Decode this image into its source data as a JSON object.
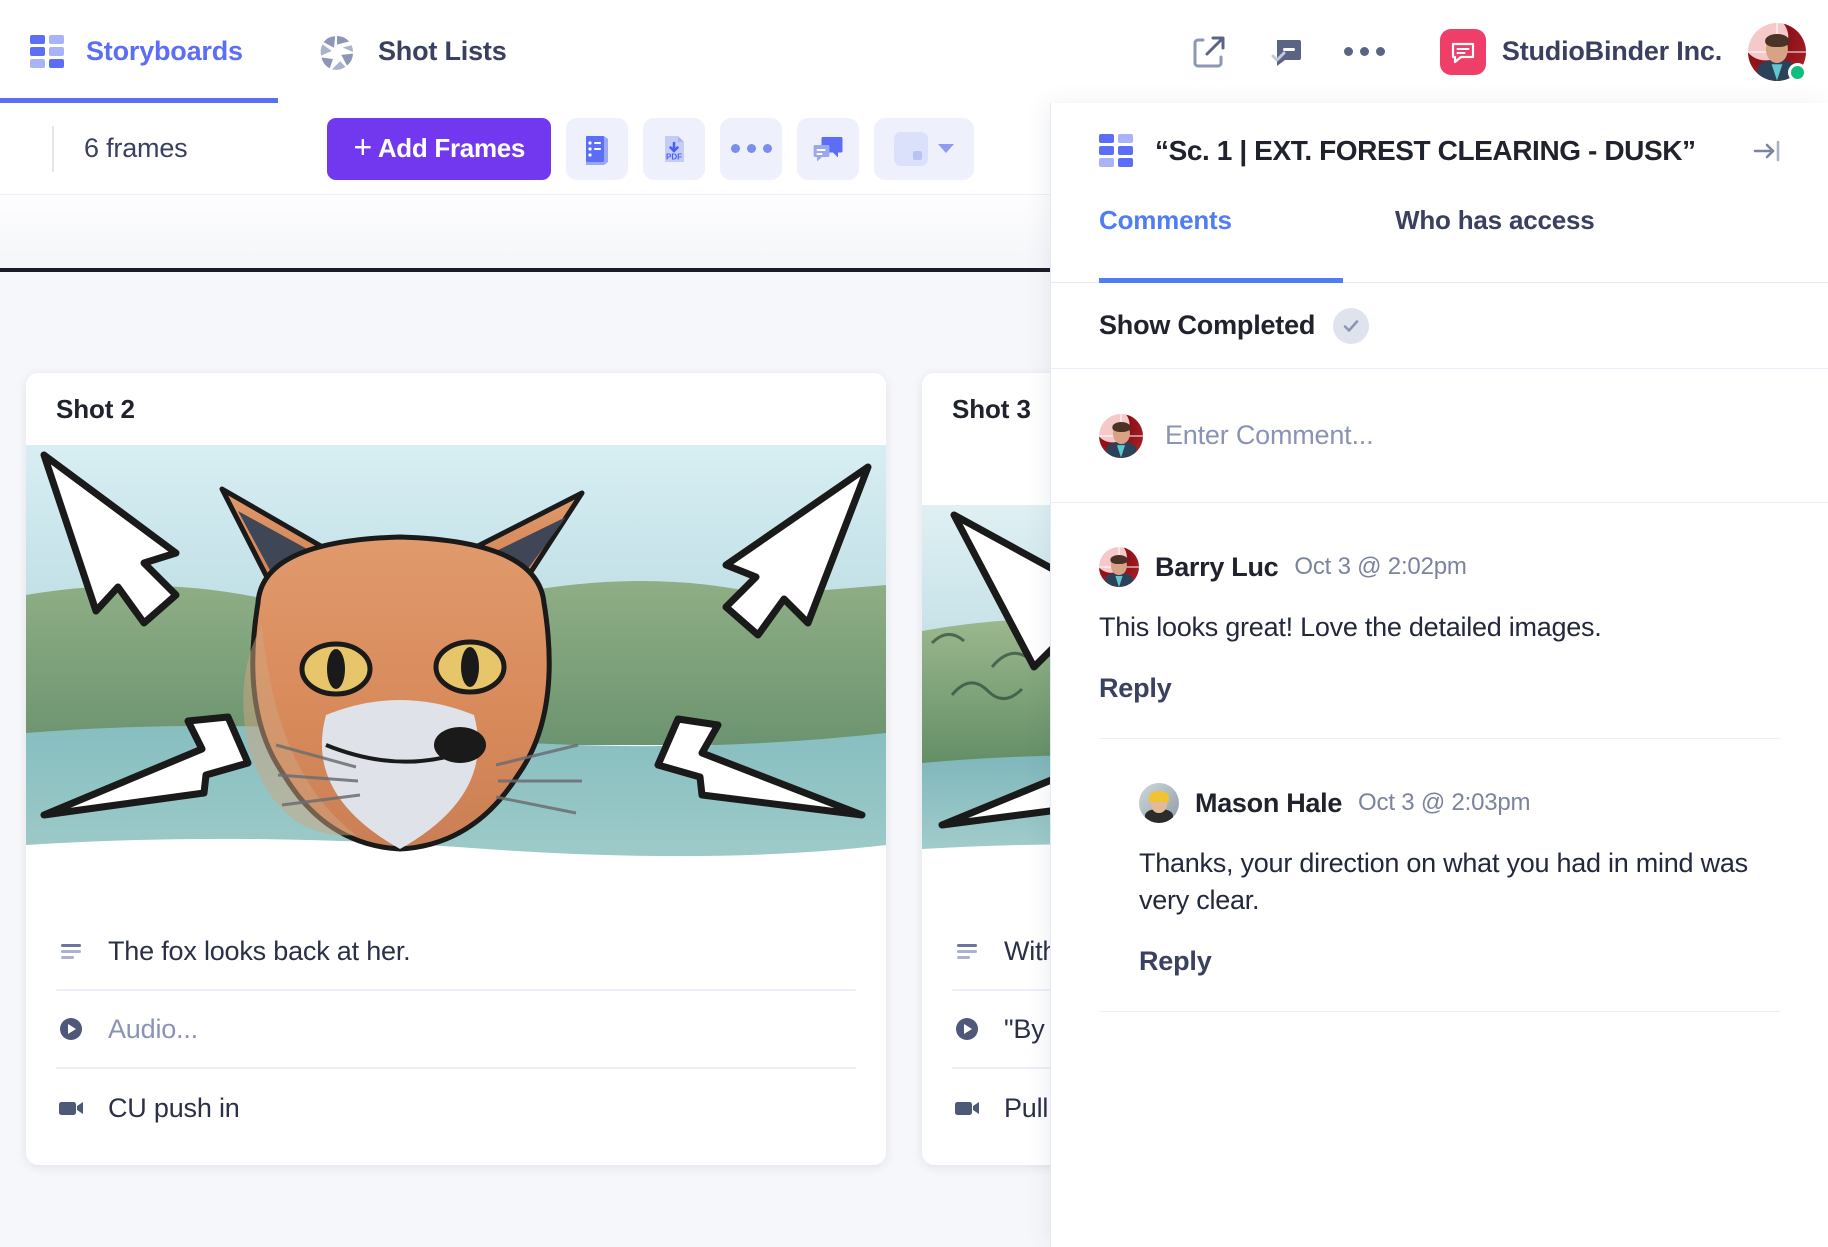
{
  "nav": {
    "tabs": [
      {
        "label": "Storyboards",
        "icon": "grid-icon",
        "active": true
      },
      {
        "label": "Shot Lists",
        "icon": "aperture-icon",
        "active": false
      }
    ],
    "actions": [
      {
        "name": "share-icon",
        "label": "Share"
      },
      {
        "name": "comment-approve-icon",
        "label": "Comments"
      },
      {
        "name": "more-options-icon",
        "label": "More"
      }
    ],
    "org_name": "StudioBinder Inc.",
    "org_logo": "chat-bubble-icon",
    "user_avatar": "user-avatar",
    "presence": "online"
  },
  "toolbar": {
    "frames_count": "6 frames",
    "add_frames_label": "Add Frames",
    "add_frames_plus": "+",
    "buttons": [
      {
        "name": "list-view-icon",
        "label": "List View"
      },
      {
        "name": "download-pdf-icon",
        "label": "Download PDF"
      },
      {
        "name": "more-options-icon",
        "label": "More"
      },
      {
        "name": "comments-icon",
        "label": "Comments"
      },
      {
        "name": "layout-size-icon",
        "label": "Card Size"
      }
    ]
  },
  "board": {
    "cards": [
      {
        "title": "Shot  2",
        "description": "The fox looks back at her.",
        "audio": "Audio...",
        "audio_muted": true,
        "camera": "CU push in"
      },
      {
        "title": "Shot  3",
        "description": "With",
        "audio": "\"By t",
        "audio_muted": false,
        "camera": "Pull"
      }
    ]
  },
  "panel": {
    "title": "“Sc. 1 | EXT. FOREST CLEARING - DUSK”",
    "header_icon": "grid-icon",
    "collapse_icon": "collapse-panel-icon",
    "tabs": [
      {
        "label": "Comments",
        "active": true
      },
      {
        "label": "Who has access",
        "active": false
      }
    ],
    "show_completed_label": "Show Completed",
    "comment_placeholder": "Enter Comment...",
    "reply_label": "Reply",
    "comments": [
      {
        "author": "Barry Luc",
        "time": "Oct 3 @ 2:02pm",
        "body": "This looks great! Love the detailed images.",
        "reply": "Reply",
        "avatar": "red",
        "nested": false
      },
      {
        "author": "Mason Hale",
        "time": "Oct 3 @ 2:03pm",
        "body": "Thanks, your direction on what you had in mind was very clear.",
        "reply": "Reply",
        "avatar": "gray",
        "nested": true
      }
    ]
  },
  "colors": {
    "accent_purple": "#7138f0",
    "accent_blue": "#5b6ef5",
    "tab_blue": "#4f7df3",
    "brand_pink": "#ef3e67",
    "presence_green": "#0fbd7e",
    "text_dark": "#20232e",
    "text_muted": "#8b93b4"
  }
}
